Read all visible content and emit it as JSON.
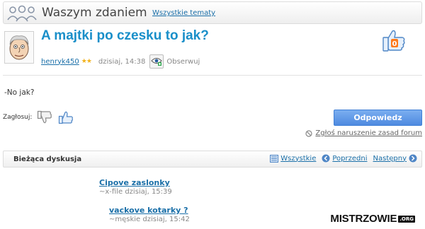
{
  "header": {
    "icon": "group-people-icon",
    "title": "Waszym zdaniem",
    "all_topics_link": "Wszystkie tematy"
  },
  "post": {
    "avatar_icon": "avatar-old-man-cartoon",
    "title": "A majtki po czesku to jak?",
    "author": "henryk450",
    "rank_stars": "★★",
    "date": "dzisiaj, 14:38",
    "watch_icon": "eye-plus-icon",
    "watch_label": "Obserwuj",
    "thumb_badge_icon": "thumb-up-zero-badge-icon",
    "thumb_badge_value": "0",
    "body": "-No jak?"
  },
  "vote": {
    "label": "Zagłosuj:",
    "down_icon": "thumb-down-icon",
    "up_icon": "thumb-up-icon"
  },
  "actions": {
    "reply_label": "Odpowiedz",
    "report_label": "Zgłoś naruszenie zasad forum",
    "report_icon": "ban-icon"
  },
  "discussion": {
    "title": "Bieżąca dyskusja",
    "nav_all": "Wszystkie",
    "nav_prev": "Poprzedni",
    "nav_next": "Następny",
    "items": [
      {
        "title": "Cipove zaslonky",
        "meta": "~x-file dzisiaj, 15:39"
      },
      {
        "title": "vackove kotarky ?",
        "meta": "~męskie dzisiaj, 15:42"
      }
    ]
  },
  "watermark": {
    "main": "MISTRZOWIE",
    "suffix": ".ORG"
  },
  "colors": {
    "link": "#1a6fa8",
    "title_blue": "#1a8fc9",
    "reply_button": "#5b93e4",
    "stars": "#f2b21b"
  }
}
